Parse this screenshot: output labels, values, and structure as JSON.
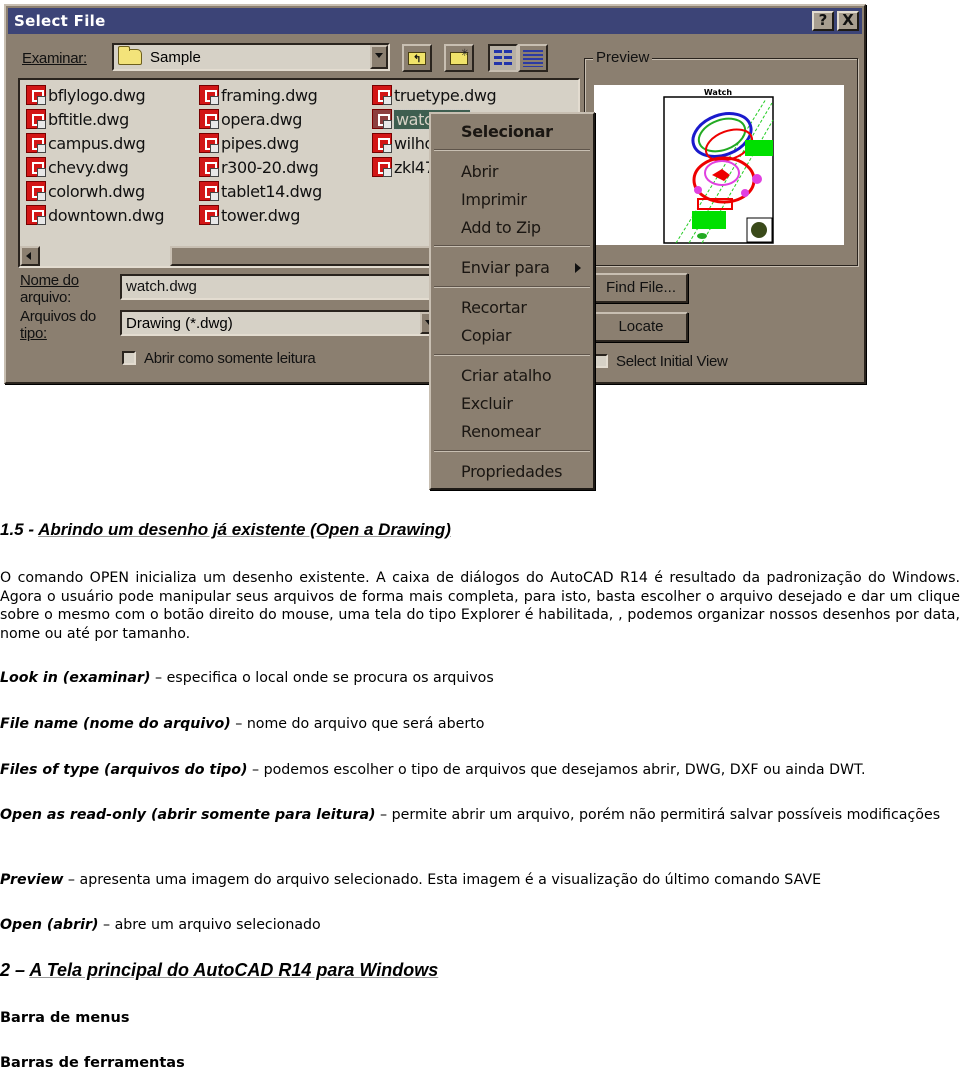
{
  "dialog": {
    "title": "Select File",
    "help_button": "?",
    "close_button": "X",
    "look_in_label": "Examinar:",
    "look_in_value": "Sample",
    "files": [
      {
        "name": "bflylogo.dwg",
        "selected": false
      },
      {
        "name": "bftitle.dwg",
        "selected": false
      },
      {
        "name": "campus.dwg",
        "selected": false
      },
      {
        "name": "chevy.dwg",
        "selected": false
      },
      {
        "name": "colorwh.dwg",
        "selected": false
      },
      {
        "name": "downtown.dwg",
        "selected": false
      },
      {
        "name": "framing.dwg",
        "selected": false
      },
      {
        "name": "opera.dwg",
        "selected": false
      },
      {
        "name": "pipes.dwg",
        "selected": false
      },
      {
        "name": "r300-20.dwg",
        "selected": false
      },
      {
        "name": "tablet14.dwg",
        "selected": false
      },
      {
        "name": "tower.dwg",
        "selected": false
      },
      {
        "name": "truetype.dwg",
        "selected": false
      },
      {
        "name": "watch.dwg",
        "selected": true,
        "visible_text": "watch"
      },
      {
        "name": "wilho",
        "selected": false
      },
      {
        "name": "zkl47",
        "selected": false
      }
    ],
    "file_name_label_1": "Nome do",
    "file_name_label_2": "arquivo:",
    "file_name_value": "watch.dwg",
    "file_type_label_1": "Arquivos do",
    "file_type_label_2": "tipo:",
    "file_type_value": "Drawing (*.dwg)",
    "read_only_label": "Abrir como somente leitura",
    "read_only_checked": false,
    "preview_label": "Preview",
    "preview_drawing_title": "Watch",
    "find_file_button": "Find File...",
    "locate_button": "Locate",
    "select_initial_view_label": "Select Initial View",
    "select_initial_view_checked": false
  },
  "context_menu": {
    "items": [
      {
        "label": "Selecionar",
        "bold": true
      },
      {
        "label": "Abrir"
      },
      {
        "label": "Imprimir"
      },
      {
        "label": "Add to Zip"
      },
      {
        "label": "Enviar para",
        "submenu": true
      },
      {
        "label": "Recortar"
      },
      {
        "label": "Copiar"
      },
      {
        "label": "Criar atalho"
      },
      {
        "label": "Excluir"
      },
      {
        "label": "Renomear"
      },
      {
        "label": "Propriedades"
      }
    ]
  },
  "document": {
    "section_number": "1.5 - ",
    "section_title": "Abrindo um desenho já existente (Open a Drawing)",
    "intro_paragraph": "O comando OPEN inicializa um desenho existente. A caixa de diálogos do AutoCAD R14 é resultado da padronização do Windows. Agora o usuário pode manipular seus arquivos de forma mais completa, para isto, basta escolher o arquivo desejado e dar um clique sobre o mesmo com o botão direito do mouse, uma tela do tipo Explorer é habilitada, , podemos organizar nossos desenhos por data, nome ou até por tamanho.",
    "definitions": [
      {
        "term": "Look in (examinar)",
        "desc": "especifica o local onde se procura os arquivos"
      },
      {
        "term": "File name (nome do arquivo)",
        "desc": "nome do arquivo que será aberto"
      },
      {
        "term": "Files of type (arquivos do tipo)",
        "desc": "podemos escolher o tipo de arquivos que desejamos abrir, DWG, DXF ou ainda DWT."
      },
      {
        "term": "Open as read-only (abrir somente para leitura)",
        "desc": "permite abrir um arquivo, porém não permitirá salvar possíveis modificações"
      },
      {
        "term": "Preview",
        "desc": "apresenta uma imagem do arquivo selecionado. Esta imagem é a visualização do último comando SAVE"
      },
      {
        "term": "Open (abrir)",
        "desc": "abre um arquivo selecionado"
      }
    ],
    "dash": " – ",
    "section2_number": "2 – ",
    "section2_title": "A Tela principal do AutoCAD R14 para Windows",
    "subheading_1": "Barra de menus",
    "subheading_2": "Barras de ferramentas"
  }
}
